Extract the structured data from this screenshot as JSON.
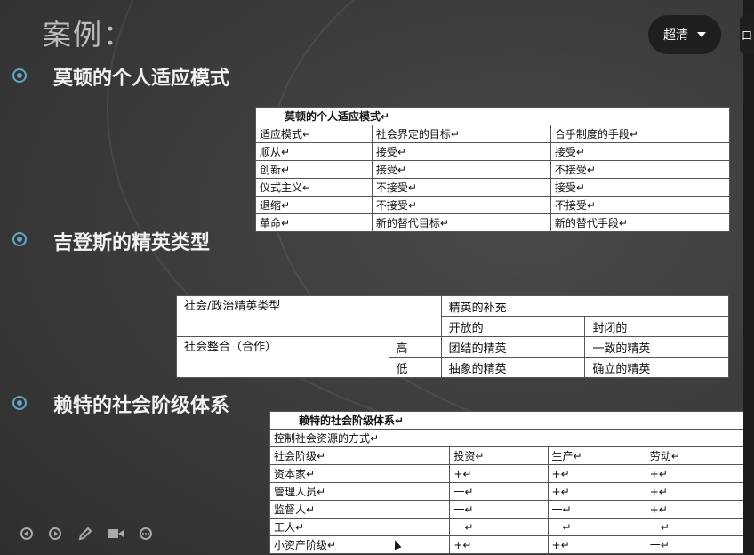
{
  "slide": {
    "title": "案例：",
    "bullets": [
      "莫顿的个人适应模式",
      "吉登斯的精英类型",
      "赖特的社会阶级体系"
    ]
  },
  "table1": {
    "caption": "莫顿的个人适应模式↵",
    "header": [
      "适应模式↵",
      "社会界定的目标↵",
      "合乎制度的手段↵"
    ],
    "rows": [
      [
        "顺从↵",
        "接受↵",
        "接受↵"
      ],
      [
        "创新↵",
        "接受↵",
        "不接受↵"
      ],
      [
        "仪式主义↵",
        "不接受↵",
        "接受↵"
      ],
      [
        "退缩↵",
        "不接受↵",
        "不接受↵"
      ],
      [
        "革命↵",
        "新的替代目标↵",
        "新的替代手段↵"
      ]
    ]
  },
  "table2": {
    "corner": "社会/政治精英类型",
    "group": "精英的补充",
    "open": "开放的",
    "closed": "封闭的",
    "row_label": "社会整合（合作）",
    "high": "高",
    "low": "低",
    "cells": [
      [
        "团结的精英",
        "一致的精英"
      ],
      [
        "抽象的精英",
        "确立的精英"
      ]
    ]
  },
  "table3": {
    "caption": "赖特的社会阶级体系↵",
    "subcaption": "控制社会资源的方式↵",
    "header": [
      "社会阶级↵",
      "投资↵",
      "生产↵",
      "劳动↵"
    ],
    "rows": [
      [
        "资本家↵",
        "+↵",
        "+↵",
        "+↵"
      ],
      [
        "管理人员↵",
        "一↵",
        "+↵",
        "+↵"
      ],
      [
        "监督人↵",
        "一↵",
        "一↵",
        "+↵"
      ],
      [
        "工人↵",
        "一↵",
        "一↵",
        "一↵"
      ],
      [
        "小资产阶级↵",
        "+↵",
        "+↵",
        "一↵"
      ]
    ]
  },
  "player": {
    "quality_label": "超清",
    "side_label": "口"
  }
}
